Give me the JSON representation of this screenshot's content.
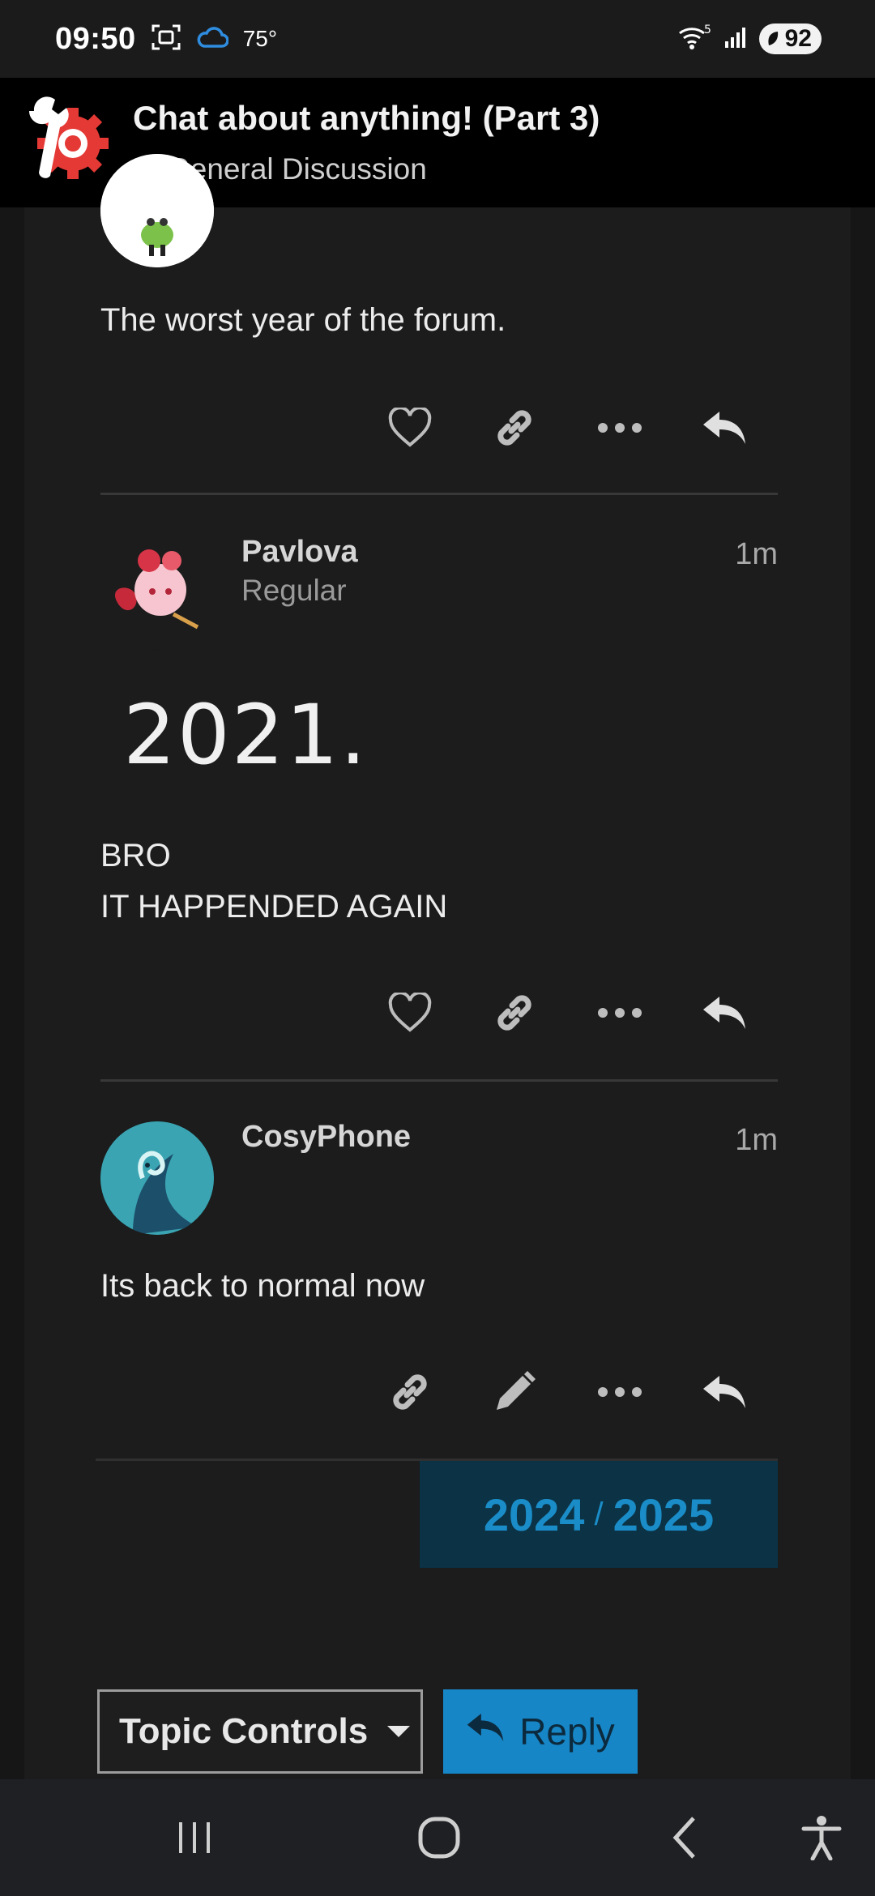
{
  "status_bar": {
    "time": "09:50",
    "temperature": "75°",
    "network": "5",
    "battery": "92"
  },
  "header": {
    "title": "Chat about anything! (Part 3)",
    "category": "General Discussion",
    "category_color": "#1a93d8"
  },
  "posts": [
    {
      "text": "The worst year of the forum.",
      "actions": [
        "heart-icon",
        "link-icon",
        "more-icon",
        "reply-icon"
      ]
    },
    {
      "username": "Pavlova",
      "user_title": "Regular",
      "time": "1m",
      "image_text": "2021.",
      "lines": [
        "BRO",
        "IT HAPPENDED AGAIN"
      ],
      "actions": [
        "heart-icon",
        "link-icon",
        "more-icon",
        "reply-icon"
      ]
    },
    {
      "username": "CosyPhone",
      "time": "1m",
      "text": "Its back to normal now",
      "actions": [
        "link-icon",
        "pencil-icon",
        "more-icon",
        "reply-icon"
      ]
    }
  ],
  "timeline": {
    "current": "2024",
    "separator": "/",
    "total": "2025"
  },
  "footer": {
    "topic_controls_label": "Topic Controls",
    "reply_label": "Reply"
  },
  "colors": {
    "accent": "#1786c7",
    "background": "#1c1c1c"
  }
}
